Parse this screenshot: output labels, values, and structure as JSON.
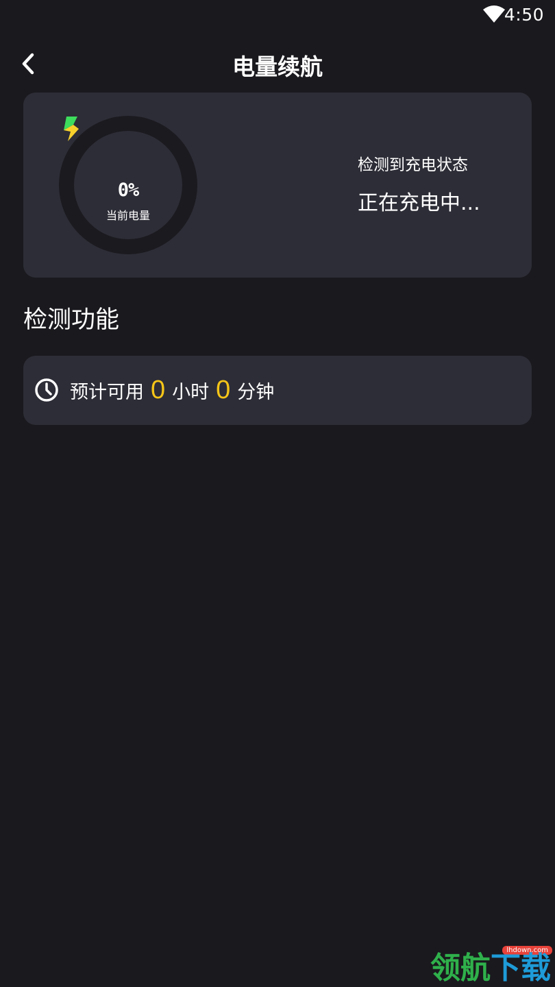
{
  "status_bar": {
    "time": "4:50",
    "wifi_icon": "wifi-icon"
  },
  "header": {
    "back_icon": "back-arrow-icon",
    "title": "电量续航"
  },
  "battery_card": {
    "level_percent": 0,
    "percent_text": "0%",
    "caption": "当前电量",
    "icon": "lightning-bolt-icon",
    "state_label": "检测到充电状态",
    "state_value": "正在充电中..."
  },
  "section": {
    "title": "检测功能"
  },
  "estimate": {
    "icon": "clock-icon",
    "prefix": "预计可用",
    "hours": "0",
    "hours_unit": "小时",
    "minutes": "0",
    "minutes_unit": "分钟"
  },
  "watermark": {
    "text_part1": "领航",
    "text_part2": "下载",
    "domain": "lhdown.com"
  },
  "colors": {
    "background": "#1a191e",
    "card": "#2d2d37",
    "ring": "#1b1a1f",
    "accent_yellow": "#f5c518",
    "bolt_green": "#3ddc5c",
    "bolt_yellow": "#f7d02c"
  }
}
